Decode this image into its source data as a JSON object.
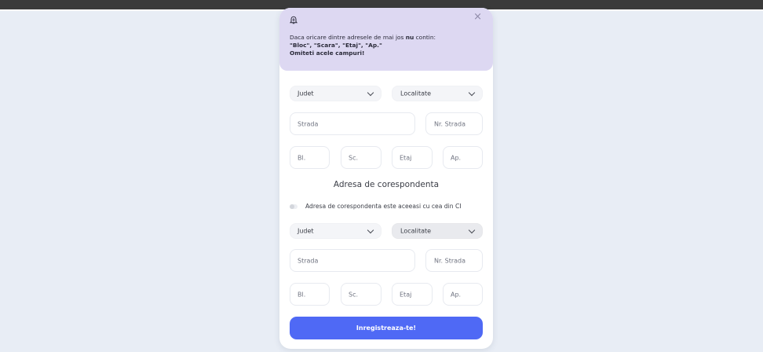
{
  "notice": {
    "line1_prefix": "Daca oricare dintre adresele de mai jos ",
    "line1_bold": "nu",
    "line1_suffix": " contin:",
    "line2": "\"Bloc\", \"Scara\", \"Etaj\", \"Ap.\"",
    "line3": "Omiteti acele campuri!",
    "close_label": "×"
  },
  "address1": {
    "county": "Judet",
    "locality": "Localitate",
    "street": "Strada",
    "street_no": "Nr. Strada",
    "block": "Bl.",
    "stair": "Sc.",
    "floor": "Etaj",
    "apartment": "Ap."
  },
  "correspondence": {
    "title": "Adresa de corespondenta",
    "toggle_label": "Adresa de corespondenta este aceeasi cu cea din CI"
  },
  "address2": {
    "county": "Judet",
    "locality": "Localitate",
    "street": "Strada",
    "street_no": "Nr. Strada",
    "block": "Bl.",
    "stair": "Sc.",
    "floor": "Etaj",
    "apartment": "Ap."
  },
  "submit_label": "Inregistreaza-te!",
  "colors": {
    "page_bg": "#e8edf5",
    "notice_bg": "#ddd8f2",
    "accent": "#4f69f5"
  }
}
